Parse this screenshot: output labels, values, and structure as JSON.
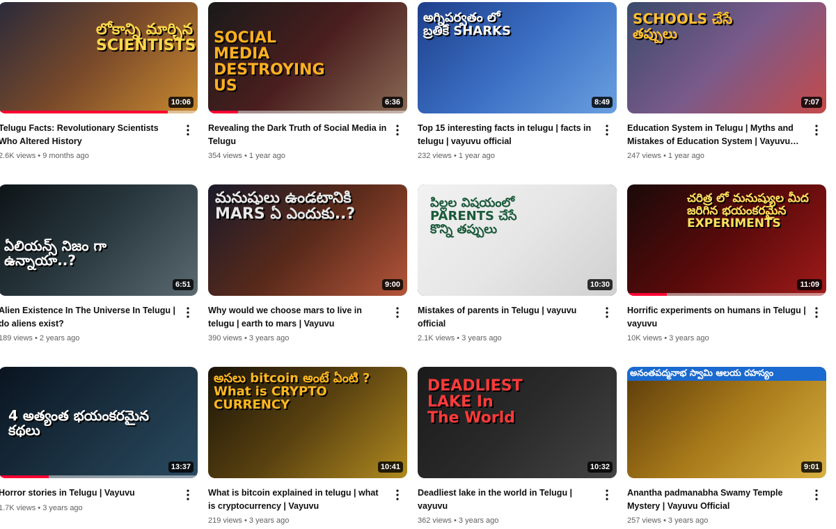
{
  "videos": [
    {
      "title": "Telugu Facts: Revolutionary Scientists Who Altered History",
      "views": "2.6K views",
      "age": "9 months ago",
      "duration": "10:06",
      "thumb_text": "లోకాన్ని మార్చిన SCIENTISTS",
      "watched_fraction": 0.85,
      "palette": [
        "#2b2a3a",
        "#7a4a2a",
        "#c98a30"
      ]
    },
    {
      "title": "Revealing the Dark Truth of Social Media in Telugu",
      "views": "354 views",
      "age": "1 year ago",
      "duration": "6:36",
      "thumb_text": "SOCIAL MEDIA DESTROYING US",
      "watched_fraction": 0.15,
      "palette": [
        "#1a1a1a",
        "#4a1e1e",
        "#8a6a55"
      ]
    },
    {
      "title": "Top 15 interesting facts in telugu | facts in telugu | vayuvu official",
      "views": "232 views",
      "age": "1 year ago",
      "duration": "8:49",
      "thumb_text": "అగ్నిపర్వతం లో బ్రతికే SHARKS",
      "watched_fraction": 0,
      "palette": [
        "#1e3f8a",
        "#3b6fc4",
        "#6aa0e0"
      ]
    },
    {
      "title": "Education System in Telugu | Myths and Mistakes of Education System | Vayuvu Official",
      "views": "247 views",
      "age": "1 year ago",
      "duration": "7:07",
      "thumb_text": "SCHOOLS చేసే తప్పులు",
      "watched_fraction": 0,
      "palette": [
        "#3a4a6a",
        "#7a5a8a",
        "#c44a4a"
      ]
    },
    {
      "title": "Alien Existence In The Universe In Telugu | do aliens exist?",
      "views": "189 views",
      "age": "2 years ago",
      "duration": "6:51",
      "thumb_text": "ఏలియన్స్ నిజం గా ఉన్నాయా..?",
      "watched_fraction": 0,
      "palette": [
        "#0e1418",
        "#2a3a40",
        "#5a6a70"
      ]
    },
    {
      "title": "Why would we choose mars to live in telugu | earth to mars | Vayuvu",
      "views": "390 views",
      "age": "3 years ago",
      "duration": "9:00",
      "thumb_text": "మనుషులు ఉండటానికి MARS ఏ ఎందుకు..?",
      "watched_fraction": 0,
      "palette": [
        "#1a1a2a",
        "#5a2a1a",
        "#b4553a"
      ]
    },
    {
      "title": "Mistakes of parents in Telugu | vayuvu official",
      "views": "2.1K views",
      "age": "3 years ago",
      "duration": "10:30",
      "thumb_text": "పిల్లల విషయంలో PARENTS చేసే కొన్ని తప్పులు",
      "watched_fraction": 0,
      "palette": [
        "#f2f2f2",
        "#e6e6e6",
        "#d0d0d0"
      ]
    },
    {
      "title": "Horrific experiments on humans in Telugu | vayuvu",
      "views": "10K views",
      "age": "3 years ago",
      "duration": "11:09",
      "thumb_text": "చరిత్ర లో మనుష్యుల మీద జరిగిన భయంకరమైన EXPERIMENTS",
      "watched_fraction": 0.2,
      "palette": [
        "#1a0a0a",
        "#5a0a0a",
        "#a01a1a"
      ]
    },
    {
      "title": "Horror stories in Telugu | Vayuvu",
      "views": "1.7K views",
      "age": "3 years ago",
      "duration": "13:37",
      "thumb_text": "4 అత్యంత భయంకరమైన కథలు",
      "watched_fraction": 0.25,
      "palette": [
        "#0a1420",
        "#1a3040",
        "#2a4a60"
      ]
    },
    {
      "title": "What is bitcoin explained in telugu | what is cryptocurrency | Vayuvu",
      "views": "219 views",
      "age": "3 years ago",
      "duration": "10:41",
      "thumb_text": "అసలు bitcoin అంటే ఏంటి ? What is CRYPTO CURRENCY",
      "watched_fraction": 0,
      "palette": [
        "#1a1408",
        "#5a4210",
        "#b08a20"
      ]
    },
    {
      "title": "Deadliest lake in the world in Telugu | vayuvu",
      "views": "362 views",
      "age": "3 years ago",
      "duration": "10:32",
      "thumb_text": "DEADLIEST LAKE In The World",
      "watched_fraction": 0,
      "palette": [
        "#1a1a1a",
        "#2a2a2a",
        "#444444"
      ]
    },
    {
      "title": "Anantha padmanabha Swamy Temple Mystery | Vayuvu Official",
      "views": "257 views",
      "age": "3 years ago",
      "duration": "9:01",
      "thumb_text": "అనంతపద్మనాభ స్వామి ఆలయ రహస్యం",
      "watched_fraction": 0,
      "palette": [
        "#5a3a0a",
        "#a87a1a",
        "#d8b040"
      ]
    }
  ]
}
